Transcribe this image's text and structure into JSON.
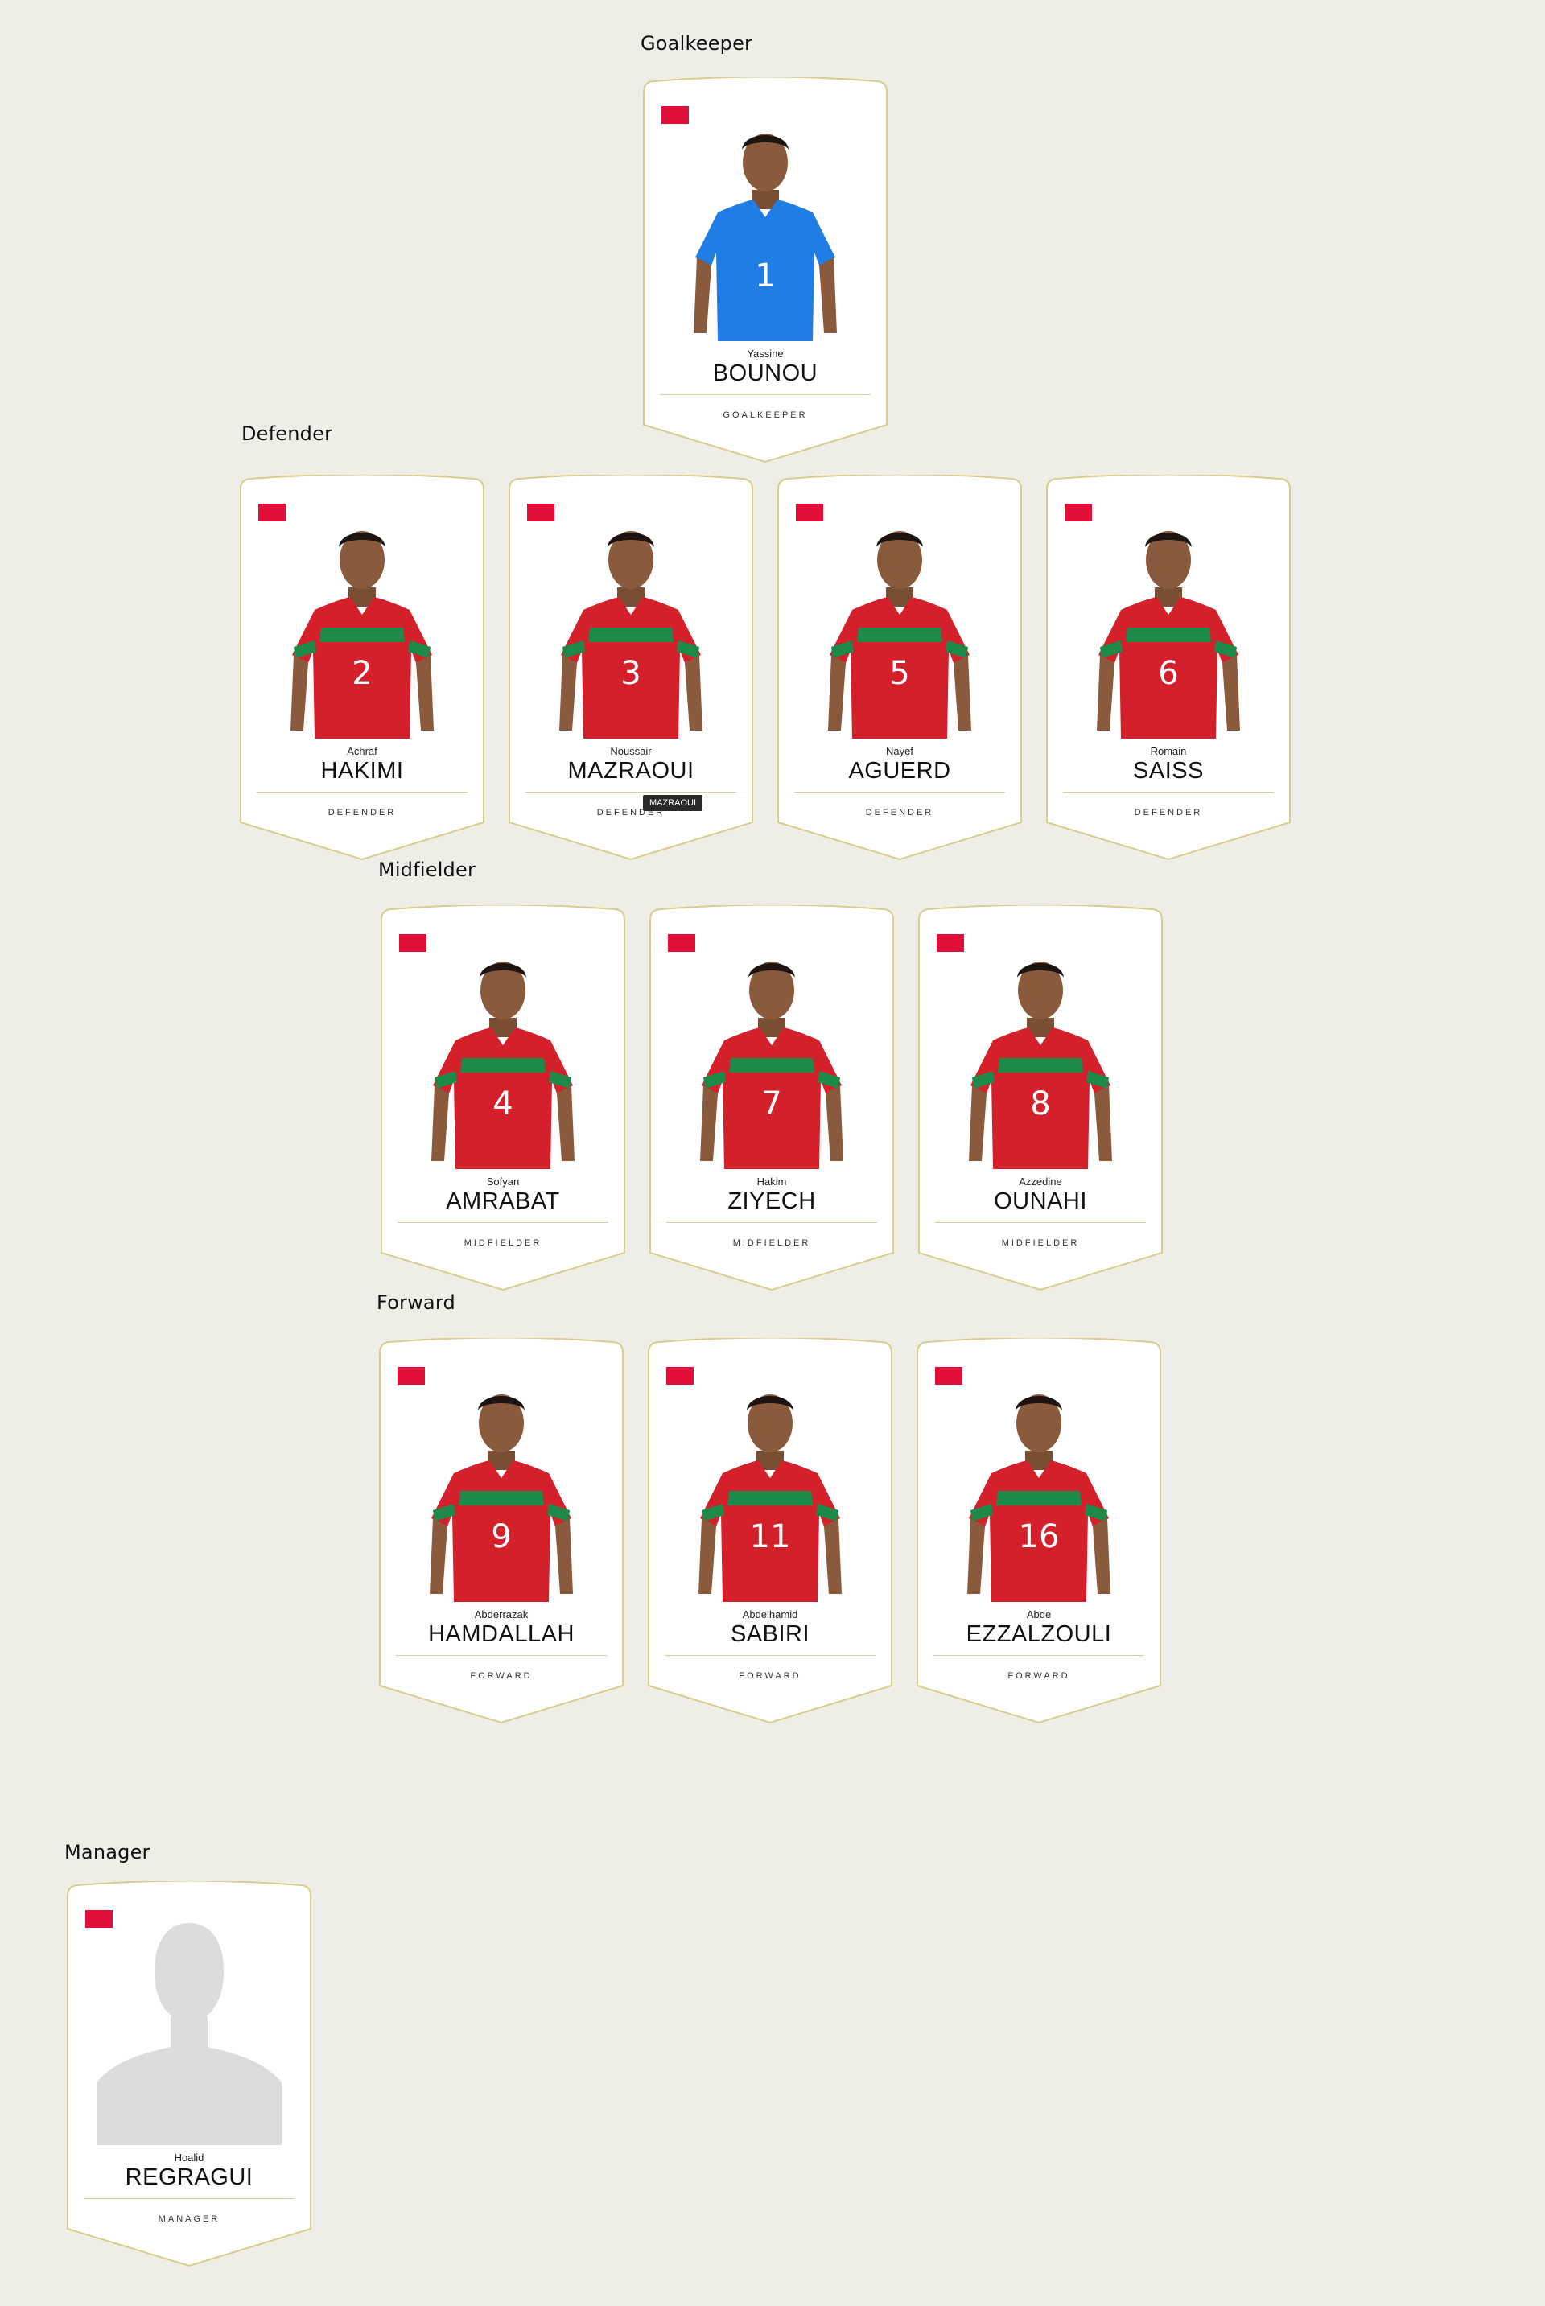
{
  "sections": {
    "goalkeeper": "Goalkeeper",
    "defender": "Defender",
    "midfielder": "Midfielder",
    "forward": "Forward",
    "manager": "Manager"
  },
  "colors": {
    "flag": "#e0103a",
    "card_border": "#d7cd8d",
    "home_shirt": "#d3202b",
    "gk_shirt": "#1f7de3",
    "stripe": "#1d8a4a"
  },
  "goalkeepers": [
    {
      "first": "Yassine",
      "last": "BOUNOU",
      "role": "GOALKEEPER",
      "number": "1",
      "kit": "blue"
    }
  ],
  "defenders": [
    {
      "first": "Achraf",
      "last": "HAKIMI",
      "role": "DEFENDER",
      "number": "2",
      "kit": "red"
    },
    {
      "first": "Noussair",
      "last": "MAZRAOUI",
      "role": "DEFENDER",
      "number": "3",
      "kit": "red",
      "tooltip": "MAZRAOUI"
    },
    {
      "first": "Nayef",
      "last": "AGUERD",
      "role": "DEFENDER",
      "number": "5",
      "kit": "red"
    },
    {
      "first": "Romain",
      "last": "SAISS",
      "role": "DEFENDER",
      "number": "6",
      "kit": "red"
    }
  ],
  "midfielders": [
    {
      "first": "Sofyan",
      "last": "AMRABAT",
      "role": "MIDFIELDER",
      "number": "4",
      "kit": "red"
    },
    {
      "first": "Hakim",
      "last": "ZIYECH",
      "role": "MIDFIELDER",
      "number": "7",
      "kit": "red"
    },
    {
      "first": "Azzedine",
      "last": "OUNAHI",
      "role": "MIDFIELDER",
      "number": "8",
      "kit": "red"
    }
  ],
  "forwards": [
    {
      "first": "Abderrazak",
      "last": "HAMDALLAH",
      "role": "FORWARD",
      "number": "9",
      "kit": "red"
    },
    {
      "first": "Abdelhamid",
      "last": "SABIRI",
      "role": "FORWARD",
      "number": "11",
      "kit": "red"
    },
    {
      "first": "Abde",
      "last": "EZZALZOULI",
      "role": "FORWARD",
      "number": "16",
      "kit": "red"
    }
  ],
  "managers": [
    {
      "first": "Hoalid",
      "last": "REGRAGUI",
      "role": "MANAGER",
      "number": "",
      "kit": "silhouette"
    }
  ]
}
